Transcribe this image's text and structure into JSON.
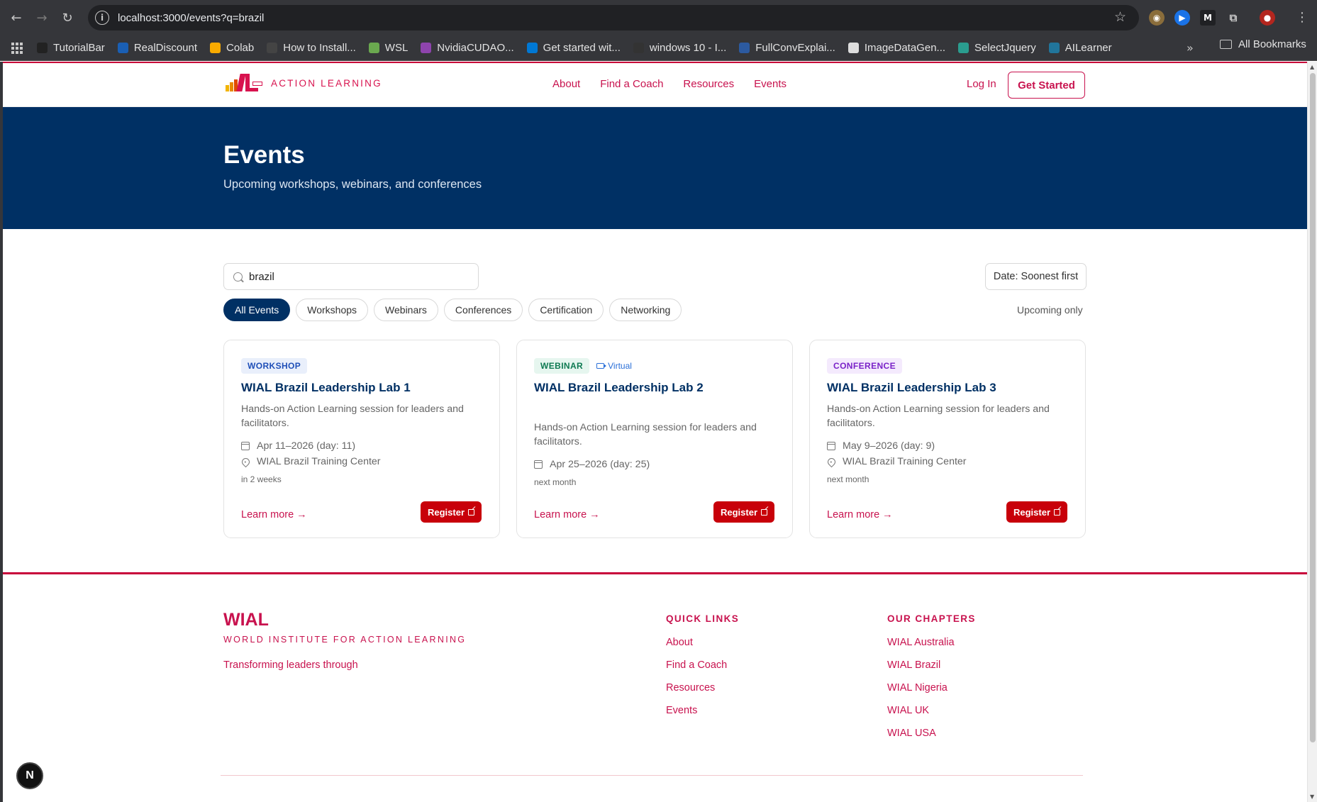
{
  "browser": {
    "url": "localhost:3000/events?q=brazil",
    "bookmarks": [
      {
        "label": "TutorialBar",
        "color": "#222222"
      },
      {
        "label": "RealDiscount",
        "color": "#1a5fb4"
      },
      {
        "label": "Colab",
        "color": "#f9ab00"
      },
      {
        "label": "How to Install...",
        "color": "#444444"
      },
      {
        "label": "WSL",
        "color": "#6aa84f"
      },
      {
        "label": "NvidiaCUDAO...",
        "color": "#8e44ad"
      },
      {
        "label": "Get started wit...",
        "color": "#0078d4"
      },
      {
        "label": "windows 10 - I...",
        "color": "#333333"
      },
      {
        "label": "FullConvExplai...",
        "color": "#2c5aa0"
      },
      {
        "label": "ImageDataGen...",
        "color": "#dddddd"
      },
      {
        "label": "SelectJquery",
        "color": "#2a9d8f"
      },
      {
        "label": "AILearner",
        "color": "#21759b"
      }
    ],
    "all_bookmarks_label": "All Bookmarks"
  },
  "header": {
    "logo_text": "ACTION LEARNING",
    "nav": [
      "About",
      "Find a Coach",
      "Resources",
      "Events"
    ],
    "login": "Log In",
    "cta": "Get Started"
  },
  "hero": {
    "title": "Events",
    "subtitle": "Upcoming workshops, webinars, and conferences"
  },
  "search": {
    "value": "brazil"
  },
  "sort": {
    "label": "Date: Soonest first"
  },
  "filters": {
    "chips": [
      "All Events",
      "Workshops",
      "Webinars",
      "Conferences",
      "Certification",
      "Networking"
    ],
    "active": "All Events",
    "upcoming_label": "Upcoming only"
  },
  "events": [
    {
      "badge": "WORKSHOP",
      "virtual": "",
      "title": "WIAL Brazil Leadership Lab 1",
      "description": "Hands-on Action Learning session for leaders and facilitators.",
      "date": "Apr 11–2026 (day: 11)",
      "location": "WIAL Brazil Training Center",
      "relative": "in 2 weeks",
      "learn_more": "Learn more →",
      "register": "Register"
    },
    {
      "badge": "WEBINAR",
      "virtual": "Virtual",
      "title": "WIAL Brazil Leadership Lab 2",
      "description": "Hands-on Action Learning session for leaders and facilitators.",
      "date": "Apr 25–2026 (day: 25)",
      "location": "",
      "relative": "next month",
      "learn_more": "Learn more →",
      "register": "Register"
    },
    {
      "badge": "CONFERENCE",
      "virtual": "",
      "title": "WIAL Brazil Leadership Lab 3",
      "description": "Hands-on Action Learning session for leaders and facilitators.",
      "date": "May 9–2026 (day: 9)",
      "location": "WIAL Brazil Training Center",
      "relative": "next month",
      "learn_more": "Learn more →",
      "register": "Register"
    }
  ],
  "footer": {
    "brand": "WIAL",
    "brand_sub": "WORLD INSTITUTE FOR ACTION LEARNING",
    "tagline": "Transforming leaders through",
    "quick_links_title": "QUICK LINKS",
    "quick_links": [
      "About",
      "Find a Coach",
      "Resources",
      "Events"
    ],
    "chapters_title": "OUR CHAPTERS",
    "chapters": [
      "WIAL Australia",
      "WIAL Brazil",
      "WIAL Nigeria",
      "WIAL UK",
      "WIAL USA"
    ]
  },
  "dev_badge": "N"
}
